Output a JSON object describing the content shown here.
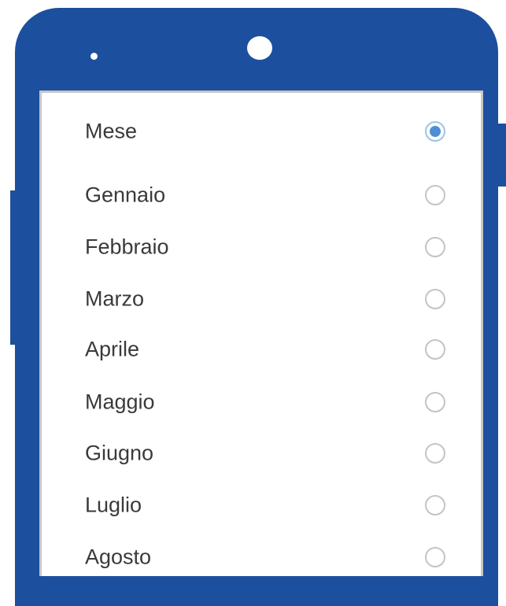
{
  "device": {
    "frame_color": "#1d4f9f",
    "camera": "camera-icon",
    "sensor": "sensor-icon"
  },
  "radio_group": {
    "header": {
      "label": "Mese",
      "selected": true
    },
    "options": [
      {
        "label": "Gennaio",
        "selected": false
      },
      {
        "label": "Febbraio",
        "selected": false
      },
      {
        "label": "Marzo",
        "selected": false
      },
      {
        "label": "Aprile",
        "selected": false
      },
      {
        "label": "Maggio",
        "selected": false
      },
      {
        "label": "Giugno",
        "selected": false
      },
      {
        "label": "Luglio",
        "selected": false
      },
      {
        "label": "Agosto",
        "selected": false
      }
    ],
    "selected_color": "#4d8fd4",
    "unselected_color": "#c4c4c4"
  }
}
